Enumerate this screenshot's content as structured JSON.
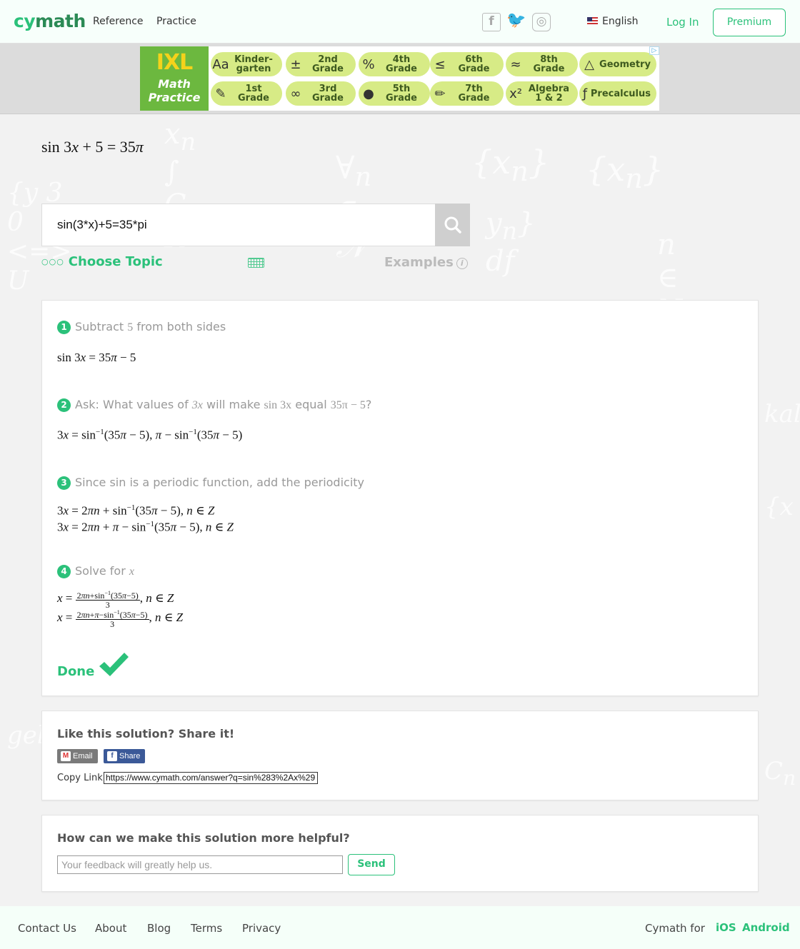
{
  "header": {
    "logo_pre": "cy",
    "logo_post": "math",
    "nav": [
      "Reference",
      "Practice"
    ],
    "social_icons": [
      "facebook-icon",
      "twitter-icon",
      "instagram-icon"
    ],
    "language": "English",
    "login": "Log In",
    "premium": "Premium"
  },
  "ad": {
    "brand": "IXL",
    "brand_sub_1": "Math",
    "brand_sub_2": "Practice",
    "pills": [
      {
        "icon": "Aa",
        "line1": "Kinder-",
        "line2": "garten"
      },
      {
        "icon": "±",
        "line1": "2nd",
        "line2": "Grade"
      },
      {
        "icon": "%",
        "line1": "4th",
        "line2": "Grade"
      },
      {
        "icon": "≤",
        "line1": "6th",
        "line2": "Grade"
      },
      {
        "icon": "≈",
        "line1": "8th",
        "line2": "Grade"
      },
      {
        "icon": "△",
        "line1": "Geometry",
        "line2": ""
      },
      {
        "icon": "✎",
        "line1": "1st",
        "line2": "Grade"
      },
      {
        "icon": "∞",
        "line1": "3rd",
        "line2": "Grade"
      },
      {
        "icon": "●",
        "line1": "5th",
        "line2": "Grade"
      },
      {
        "icon": "✏",
        "line1": "7th",
        "line2": "Grade"
      },
      {
        "icon": "x²",
        "line1": "Algebra",
        "line2": "1 & 2"
      },
      {
        "icon": "ƒ",
        "line1": "Precalculus",
        "line2": ""
      }
    ]
  },
  "problem": {
    "display": "sin 3x + 5 = 35π",
    "input_value": "sin(3*x)+5=35*pi",
    "choose_topic": "Choose Topic",
    "examples": "Examples"
  },
  "steps": [
    {
      "num": "1",
      "title_pre": "Subtract ",
      "title_math": "5",
      "title_post": " from both sides"
    },
    {
      "num": "2",
      "title_pre": "Ask: What values of ",
      "title_math": "3x",
      "title_mid": " will make ",
      "title_math2": "sin 3x",
      "title_mid2": " equal ",
      "title_math3": "35π − 5",
      "title_post": "?"
    },
    {
      "num": "3",
      "title_pre": "Since sin is a periodic function, add the periodicity"
    },
    {
      "num": "4",
      "title_pre": "Solve for ",
      "title_math": "x"
    }
  ],
  "done": "Done",
  "share": {
    "title": "Like this solution? Share it!",
    "email": "Email",
    "fb_share": "Share",
    "copy_label": "Copy Link",
    "copy_value": "https://www.cymath.com/answer?q=sin%283%2Ax%29"
  },
  "feedback": {
    "title": "How can we make this solution more helpful?",
    "placeholder": "Your feedback will greatly help us.",
    "send": "Send"
  },
  "footer": {
    "links": [
      "Contact Us",
      "About",
      "Blog",
      "Terms",
      "Privacy"
    ],
    "cymath_for": "Cymath for",
    "ios": "iOS",
    "android": "Android"
  },
  "colors": {
    "accent": "#2bc17a",
    "ad_pill": "#d7eb86",
    "ixl_green": "#6cb83f"
  }
}
